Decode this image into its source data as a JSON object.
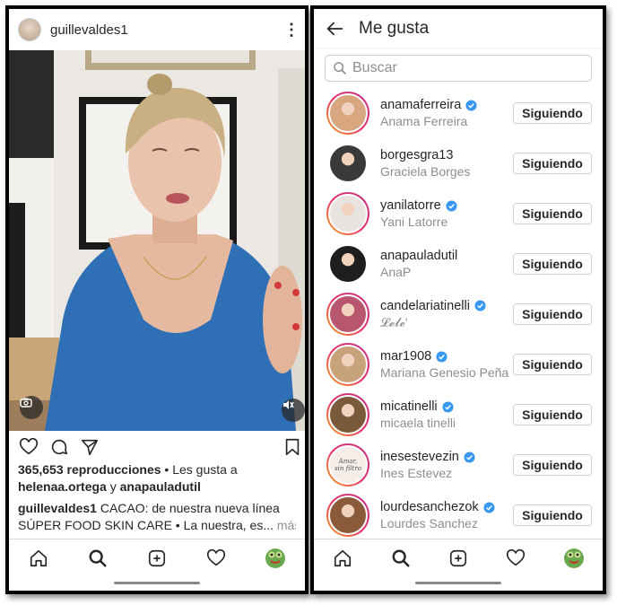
{
  "left_panel": {
    "post_username": "guillevaldes1",
    "stats": {
      "views": "365,653 reproducciones",
      "liked_by_prefix": "• Les gusta a",
      "liked_user_1": "helenaa.ortega",
      "conjunction": "y",
      "liked_user_2": "anapauladutil"
    },
    "caption": {
      "author": "guillevaldes1",
      "line1": "CACAO: de nuestra nueva línea",
      "line2": "SÚPER FOOD SKIN CARE • La nuestra, es...",
      "more": "más"
    },
    "icons": [
      "more-options-icon",
      "camera-icon",
      "mute-icon",
      "heart-icon",
      "comment-icon",
      "share-icon",
      "bookmark-icon"
    ]
  },
  "right_panel": {
    "title": "Me gusta",
    "search": {
      "placeholder": "Buscar",
      "value": ""
    },
    "follow_label": "Siguiendo",
    "likes": [
      {
        "username": "anamaferreira",
        "full_name": "Anama Ferreira",
        "verified": true,
        "story_ring": true,
        "avatar_color": "#d8a77f"
      },
      {
        "username": "borgesgra13",
        "full_name": "Graciela Borges",
        "verified": false,
        "story_ring": false,
        "avatar_color": "#3a3a3a"
      },
      {
        "username": "yanilatorre",
        "full_name": "Yani Latorre",
        "verified": true,
        "story_ring": true,
        "avatar_color": "#e9e3df"
      },
      {
        "username": "anapauladutil",
        "full_name": "AnaP",
        "verified": false,
        "story_ring": false,
        "avatar_color": "#1e1e1e"
      },
      {
        "username": "candelariatinelli",
        "full_name": "𝓛𝓮𝓵𝓮'",
        "verified": true,
        "story_ring": true,
        "avatar_color": "#b9566f"
      },
      {
        "username": "mar1908",
        "full_name": "Mariana Genesio Peña",
        "verified": true,
        "story_ring": true,
        "avatar_color": "#c8a27a"
      },
      {
        "username": "micatinelli",
        "full_name": "micaela tinelli",
        "verified": true,
        "story_ring": true,
        "avatar_color": "#7b5a3c"
      },
      {
        "username": "inesestevezin",
        "full_name": "Ines Estevez",
        "verified": true,
        "story_ring": true,
        "avatar_color": "#f4ede8",
        "avatar_text": "Amar, sin filtro"
      },
      {
        "username": "lourdesanchezok",
        "full_name": "Lourdes Sanchez",
        "verified": true,
        "story_ring": true,
        "avatar_color": "#8a5a3a"
      }
    ]
  },
  "nav_items": [
    "home-icon",
    "search-icon",
    "add-post-icon",
    "activity-heart-icon",
    "profile-avatar"
  ],
  "colors": {
    "text": "#262626",
    "secondary": "#8e8e8e",
    "verified_blue": "#3897f0",
    "border": "#dbdbdb",
    "shirt_blue": "#2f6fb5"
  }
}
